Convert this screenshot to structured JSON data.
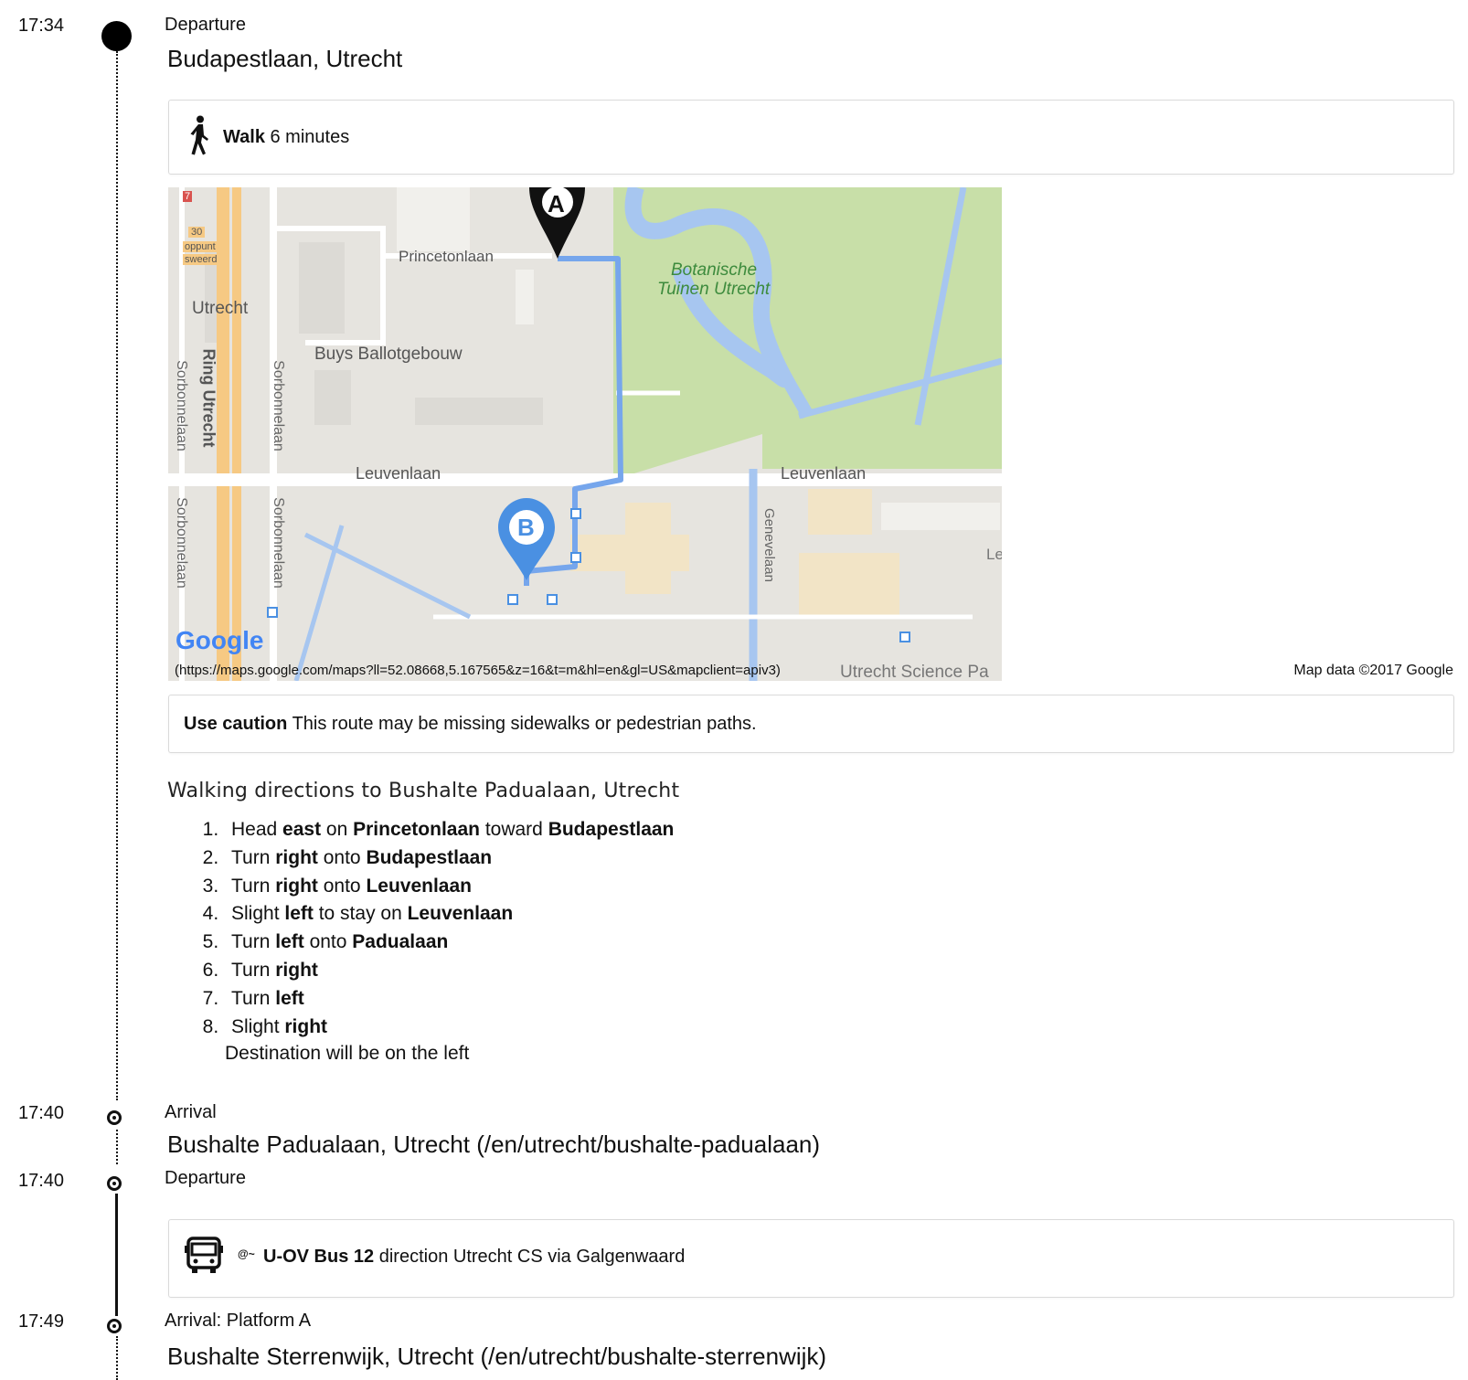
{
  "timeline": {
    "stop1": {
      "time": "17:34",
      "label": "Departure",
      "place": "Budapestlaan, Utrecht"
    },
    "walk": {
      "mode": "Walk",
      "duration": "6 minutes",
      "icon": "walking-person-icon"
    },
    "map": {
      "url": "(https://maps.google.com/maps?ll=52.08668,5.167565&z=16&t=m&hl=en&gl=US&mapclient=apiv3)",
      "credit": "Map data ©2017 Google",
      "logo": "Google",
      "labels": {
        "princetonlaan": "Princetonlaan",
        "buys": "Buys Ballotgebouw",
        "utrecht": "Utrecht",
        "ring": "Ring Utrecht",
        "sorbonnelaan": "Sorbonnelaan",
        "leuvenlaan": "Leuvenlaan",
        "botanische1": "Botanische",
        "botanische2": "Tuinen Utrecht",
        "genevelaan": "Genevelaan",
        "science": "Utrecht Science Pa",
        "le": "Le",
        "route30": "30",
        "oppunt": "oppunt",
        "sweerd": "sweerd",
        "seven": "7"
      },
      "markers": {
        "a": "A",
        "b": "B"
      }
    },
    "caution": {
      "title": "Use caution",
      "text": "This route may be missing sidewalks or pedestrian paths."
    },
    "directions": {
      "title": "Walking directions to Bushalte Padualaan, Utrecht",
      "steps": [
        [
          {
            "t": "Head "
          },
          {
            "b": "east"
          },
          {
            "t": " on "
          },
          {
            "b": "Princetonlaan"
          },
          {
            "t": " toward "
          },
          {
            "b": "Budapestlaan"
          }
        ],
        [
          {
            "t": "Turn "
          },
          {
            "b": "right"
          },
          {
            "t": " onto "
          },
          {
            "b": "Budapestlaan"
          }
        ],
        [
          {
            "t": "Turn "
          },
          {
            "b": "right"
          },
          {
            "t": " onto "
          },
          {
            "b": "Leuvenlaan"
          }
        ],
        [
          {
            "t": "Slight "
          },
          {
            "b": "left"
          },
          {
            "t": " to stay on "
          },
          {
            "b": "Leuvenlaan"
          }
        ],
        [
          {
            "t": "Turn "
          },
          {
            "b": "left"
          },
          {
            "t": " onto "
          },
          {
            "b": "Padualaan"
          }
        ],
        [
          {
            "t": "Turn "
          },
          {
            "b": "right"
          }
        ],
        [
          {
            "t": "Turn "
          },
          {
            "b": "left"
          }
        ],
        [
          {
            "t": "Slight "
          },
          {
            "b": "right"
          }
        ]
      ],
      "destination_note": "Destination will be on the left"
    },
    "stop2": {
      "time": "17:40",
      "label": "Arrival",
      "place": "Bushalte Padualaan, Utrecht (/en/utrecht/bushalte-padualaan)"
    },
    "stop3": {
      "time": "17:40",
      "label": "Departure"
    },
    "bus": {
      "operator_icon": "bus-icon",
      "badge": "@~",
      "line": "U-OV Bus 12",
      "direction": "direction Utrecht CS via Galgenwaard"
    },
    "stop4": {
      "time": "17:49",
      "label": "Arrival: Platform A",
      "place": "Bushalte Sterrenwijk, Utrecht (/en/utrecht/bushalte-sterrenwijk)"
    }
  }
}
